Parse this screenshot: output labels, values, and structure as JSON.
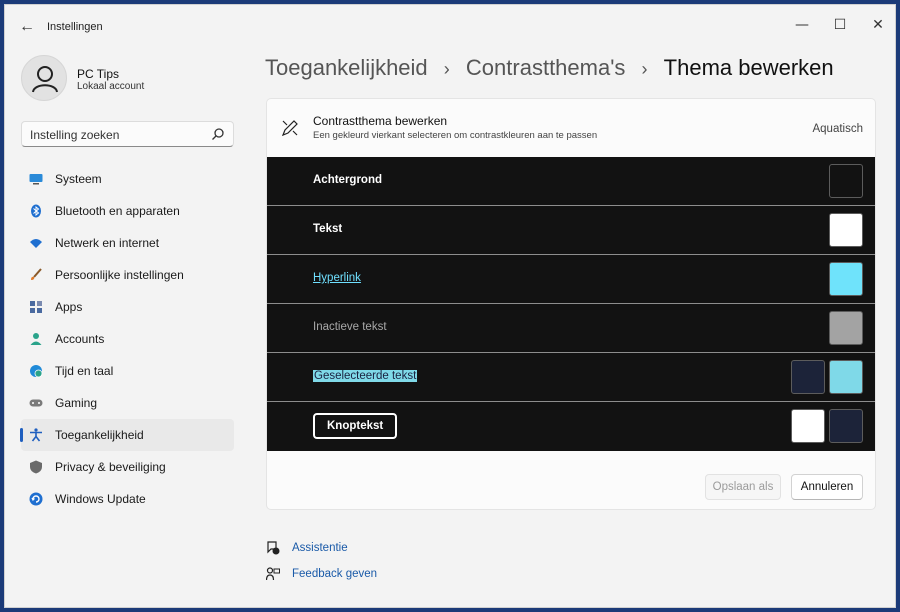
{
  "window": {
    "title": "Instellingen",
    "back_glyph": "←",
    "minimize_glyph": "—",
    "maximize_glyph": "☐",
    "close_glyph": "✕"
  },
  "profile": {
    "name": "PC Tips",
    "account_type": "Lokaal account",
    "avatar_icon": "person-icon"
  },
  "search": {
    "placeholder": "Instelling zoeken",
    "icon": "search-icon"
  },
  "sidebar": {
    "items": [
      {
        "label": "Systeem",
        "icon": "monitor-icon",
        "color": "#2a8ad8"
      },
      {
        "label": "Bluetooth en apparaten",
        "icon": "bluetooth-icon",
        "color": "#1f6fd0"
      },
      {
        "label": "Netwerk en internet",
        "icon": "wifi-icon",
        "color": "#1f6fd0"
      },
      {
        "label": "Persoonlijke instellingen",
        "icon": "brush-icon",
        "color": "#e07a2a"
      },
      {
        "label": "Apps",
        "icon": "apps-icon",
        "color": "#4a6aa0"
      },
      {
        "label": "Accounts",
        "icon": "account-icon",
        "color": "#2aa38a"
      },
      {
        "label": "Tijd en taal",
        "icon": "globe-clock-icon",
        "color": "#1f8ad8"
      },
      {
        "label": "Gaming",
        "icon": "gamepad-icon",
        "color": "#7a7a7a"
      },
      {
        "label": "Toegankelijkheid",
        "icon": "accessibility-icon",
        "color": "#1f5fbf",
        "active": true
      },
      {
        "label": "Privacy & beveiliging",
        "icon": "shield-icon",
        "color": "#6a6a6a"
      },
      {
        "label": "Windows Update",
        "icon": "update-icon",
        "color": "#1f6fd0"
      }
    ]
  },
  "breadcrumb": {
    "items": [
      "Toegankelijkheid",
      "Contrastthema's",
      "Thema bewerken"
    ],
    "separator": "›"
  },
  "editor": {
    "title": "Contrastthema bewerken",
    "subtitle": "Een gekleurd vierkant selecteren om contrastkleuren aan te passen",
    "theme_name": "Aquatisch",
    "rows": [
      {
        "label": "Achtergrond",
        "style": "normal",
        "swatches": [
          "#121212"
        ]
      },
      {
        "label": "Tekst",
        "style": "normal",
        "swatches": [
          "#ffffff"
        ]
      },
      {
        "label": "Hyperlink",
        "style": "link",
        "swatches": [
          "#6fe3fb"
        ]
      },
      {
        "label": "Inactieve tekst",
        "style": "inactive",
        "swatches": [
          "#a3a3a3"
        ]
      },
      {
        "label": "Geselecteerde tekst",
        "style": "selected",
        "swatches": [
          "#1c2339",
          "#7fd9e8"
        ]
      },
      {
        "label": "Knoptekst",
        "style": "button-text",
        "swatches": [
          "#ffffff",
          "#1c2339"
        ]
      }
    ],
    "save_label": "Opslaan als",
    "cancel_label": "Annuleren"
  },
  "help": {
    "assist_label": "Assistentie",
    "feedback_label": "Feedback geven"
  },
  "colors": {
    "accent": "#1f5fbf",
    "theme_background": "#121212",
    "hyperlink": "#6fe0ff"
  }
}
